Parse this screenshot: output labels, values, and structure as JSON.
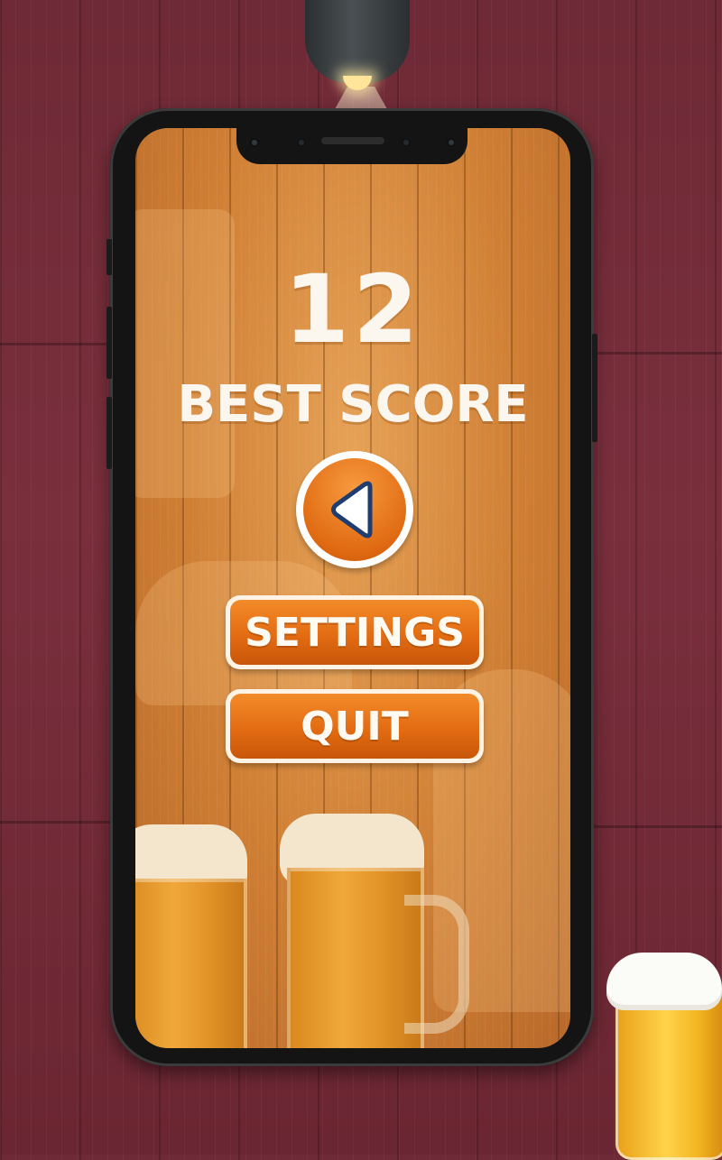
{
  "game": {
    "score": "12",
    "best_score_label": "BEST SCORE"
  },
  "menu": {
    "settings_label": "SETTINGS",
    "quit_label": "QUIT"
  },
  "icons": {
    "back": "play-back-icon"
  },
  "colors": {
    "background": "#7a2f3d",
    "button_orange": "#e36c12",
    "text_light": "#fbf6ee",
    "screen_wood": "#cf7f34"
  }
}
